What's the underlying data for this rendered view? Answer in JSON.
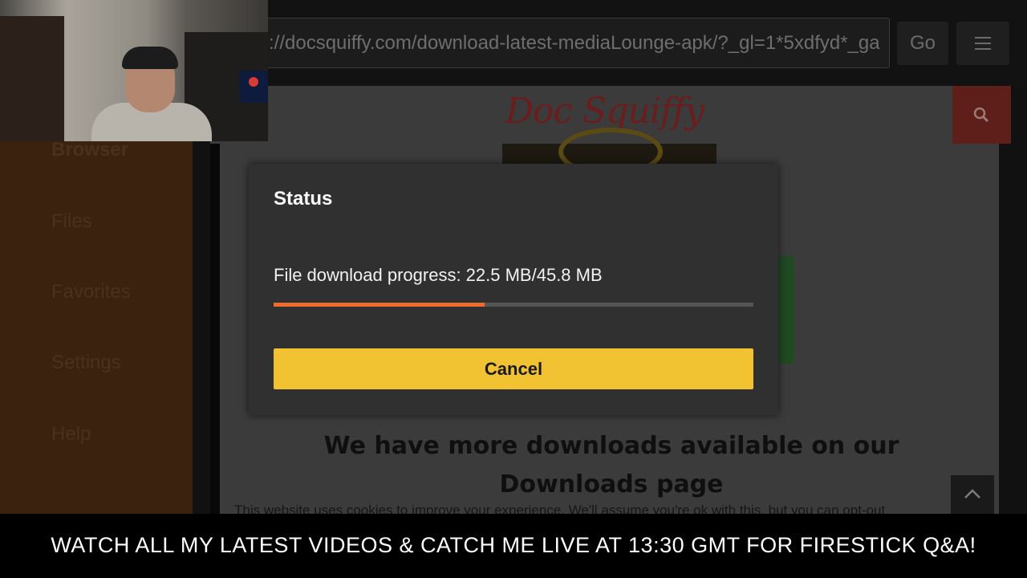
{
  "browser": {
    "url": "://docsquiffy.com/download-latest-mediaLounge-apk/?_gl=1*5xdfyd*_ga",
    "go_label": "Go",
    "menu_icon": "hamburger-icon"
  },
  "site": {
    "logo_text": "Doc Squiffy",
    "search_icon": "search-icon",
    "downloads_heading": "We have more downloads available on our Downloads page",
    "cookie_notice": "This website uses cookies to improve your experience. We'll assume you're ok with this, but you can opt-out",
    "scroll_top_icon": "chevron-up-icon"
  },
  "sidebar": {
    "items": [
      {
        "label": "Browser"
      },
      {
        "label": "Files"
      },
      {
        "label": "Favorites"
      },
      {
        "label": "Settings"
      },
      {
        "label": "Help"
      }
    ]
  },
  "dialog": {
    "title": "Status",
    "progress_text": "File download progress: 22.5 MB/45.8 MB",
    "progress_fraction": 0.44,
    "cancel_label": "Cancel",
    "progress_color": "#ee6b2c",
    "button_color": "#f1c232"
  },
  "ticker": {
    "text": "WATCH ALL MY LATEST VIDEOS & CATCH ME LIVE AT 13:30 GMT FOR FIRESTICK Q&A!"
  }
}
